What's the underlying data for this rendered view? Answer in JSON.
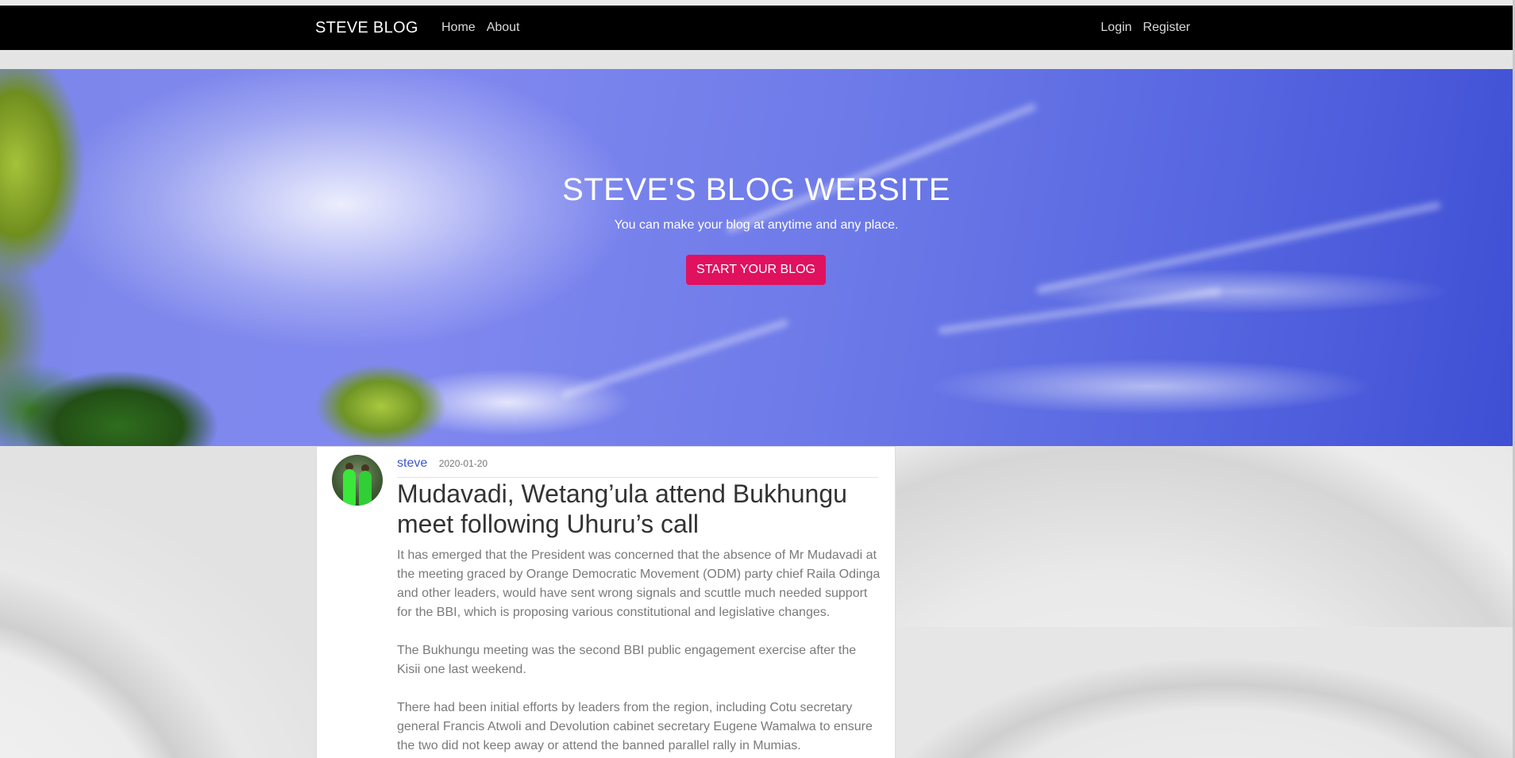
{
  "navbar": {
    "brand": "STEVE BLOG",
    "left_links": [
      "Home",
      "About"
    ],
    "right_links": [
      "Login",
      "Register"
    ]
  },
  "hero": {
    "title": "STEVE'S BLOG WEBSITE",
    "subtitle": "You can make your blog at anytime and any place.",
    "button_label": "START YOUR BLOG",
    "button_color": "#e0115f"
  },
  "post": {
    "author": "steve",
    "date": "2020-01-20",
    "title": "Mudavadi, Wetang’ula attend Bukhungu meet following Uhuru’s call",
    "paragraphs": [
      "It has emerged that the President was concerned that the absence of Mr Mudavadi at the meeting graced by Orange Democratic Movement (ODM) party chief Raila Odinga and other leaders, would have sent wrong signals and scuttle much needed support for the BBI, which is proposing various constitutional and legislative changes.",
      "The Bukhungu meeting was the second BBI public engagement exercise after the Kisii one last weekend.",
      "There had been initial efforts by leaders from the region, including Cotu secretary general Francis Atwoli and Devolution cabinet secretary Eugene Wamalwa to ensure the two did not keep away or attend the banned parallel rally in Mumias."
    ]
  },
  "colors": {
    "navbar_bg": "#000000",
    "author_link": "#3b57c9",
    "body_text": "#7a7a7a"
  }
}
